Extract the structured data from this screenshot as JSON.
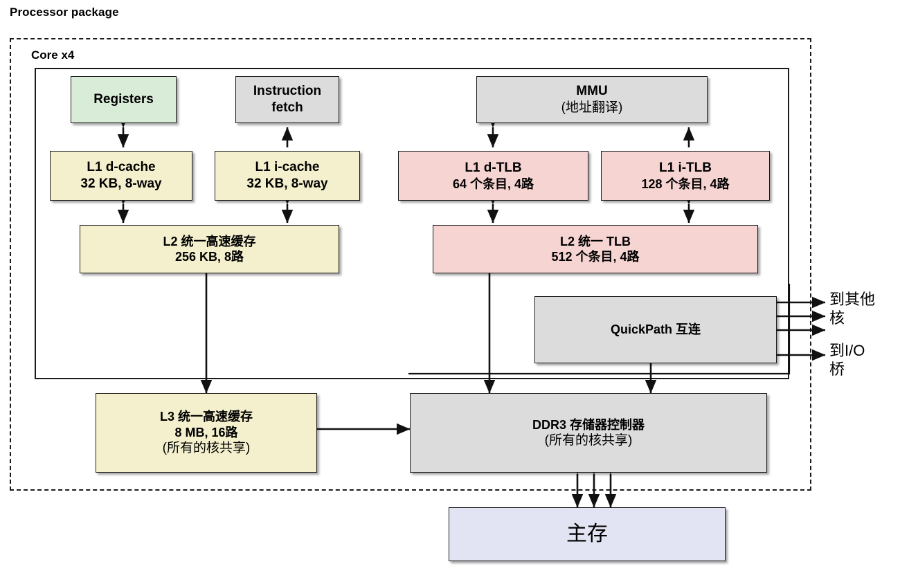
{
  "diagram": {
    "title_label": "Processor package",
    "core_label": "Core x4",
    "colors": {
      "registers": "#d9ecd8",
      "grey_unit": "#dcdcdc",
      "cache": "#f4f0cd",
      "tlb": "#f6d4d2",
      "main_memory": "#e3e4f3",
      "outline": "#1a1a1a"
    },
    "nodes": {
      "registers": {
        "line1": "Registers"
      },
      "instruction_fetch": {
        "line1": "Instruction",
        "line2": "fetch"
      },
      "mmu": {
        "line1": "MMU",
        "line2": "(地址翻译)"
      },
      "l1_dcache": {
        "line1": "L1 d-cache",
        "line2": "32 KB, 8-way"
      },
      "l1_icache": {
        "line1": "L1 i-cache",
        "line2": "32 KB, 8-way"
      },
      "l1_dtlb": {
        "line1": "L1 d-TLB",
        "line2": "64 个条目, 4路"
      },
      "l1_itlb": {
        "line1": "L1 i-TLB",
        "line2": "128 个条目, 4路"
      },
      "l2_cache": {
        "line1": "L2 统一高速缓存",
        "line2": "256 KB, 8路"
      },
      "l2_tlb": {
        "line1": "L2  统一 TLB",
        "line2": "512 个条目, 4路"
      },
      "quickpath": {
        "line1": "QuickPath 互连"
      },
      "l3_cache": {
        "line1": "L3 统一高速缓存",
        "line2": "8 MB, 16路",
        "line3": "(所有的核共享)"
      },
      "ddr3": {
        "line1": "DDR3 存储器控制器",
        "line2": "(所有的核共享)"
      },
      "main_memory": {
        "line1": "主存"
      }
    },
    "side_labels": {
      "to_other_cores": "到其他\n核",
      "to_io_bridge": "到I/O\n桥"
    }
  }
}
